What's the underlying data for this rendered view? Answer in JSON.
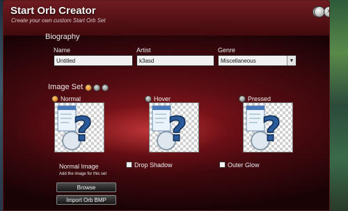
{
  "window": {
    "title": "Start Orb Creator",
    "subtitle": "Create your own custom Start Orb Set"
  },
  "top_buttons": [
    {
      "icon": "save-icon",
      "glyph": "▣"
    },
    {
      "icon": "close-icon",
      "glyph": "✕"
    }
  ],
  "biography": {
    "heading": "Biography",
    "name_label": "Name",
    "name_value": "Untitled",
    "artist_label": "Artist",
    "artist_value": "k3asd",
    "genre_label": "Genre",
    "genre_value": "Miscellaneous"
  },
  "image_set": {
    "heading": "Image Set",
    "set_dots": [
      {
        "color": "#e8801c",
        "selected": true
      },
      {
        "color": "#8a8a8a",
        "selected": false
      },
      {
        "color": "#8a8a8a",
        "selected": false
      }
    ],
    "states": [
      {
        "label": "Normal",
        "selected": true
      },
      {
        "label": "Hover",
        "selected": false
      },
      {
        "label": "Pressed",
        "selected": false
      }
    ]
  },
  "options": {
    "drop_shadow_label": "Drop Shadow",
    "drop_shadow_checked": false,
    "outer_glow_label": "Outer Glow",
    "outer_glow_checked": false
  },
  "normal_image": {
    "heading": "Normal Image",
    "hint": "Add the image for this set",
    "browse_label": "Browse",
    "import_label": "Import Orb BMP"
  },
  "colors": {
    "accent": "#e8801c",
    "window_bg": "#4a0a10"
  }
}
